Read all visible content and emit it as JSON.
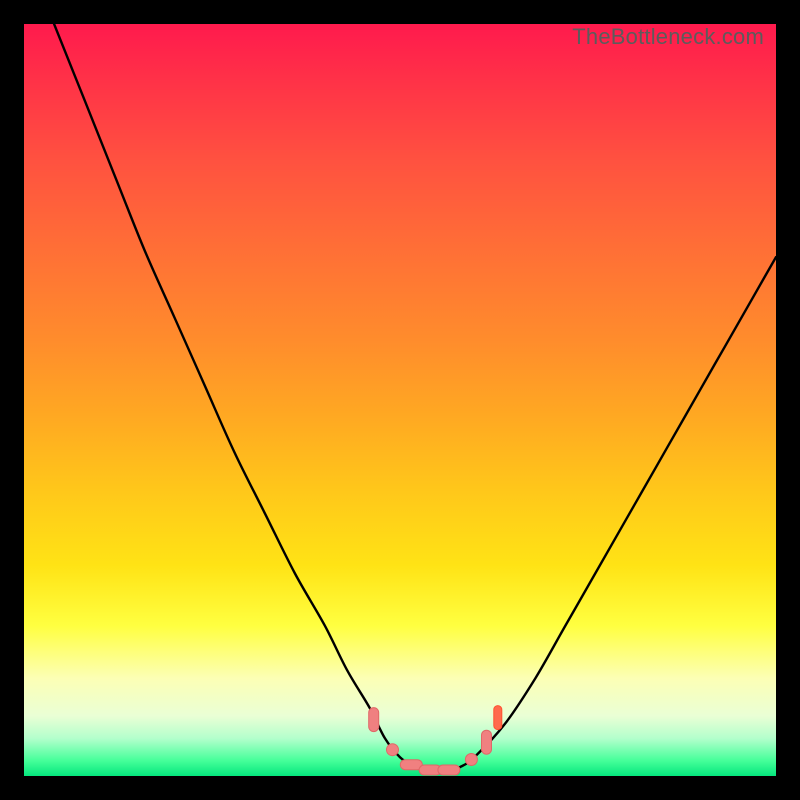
{
  "attribution": "TheBottleneck.com",
  "colors": {
    "frame": "#000000",
    "curve": "#000000",
    "markerFill": "#f08080",
    "markerStroke": "#e06868",
    "gradientStops": [
      "#ff1a4d",
      "#ff3347",
      "#ff5140",
      "#ff6f36",
      "#ff8c2c",
      "#ffa822",
      "#ffc71a",
      "#ffe315",
      "#ffff40",
      "#fcffb5",
      "#eaffd5",
      "#b3ffcc",
      "#44ff99",
      "#05e67d"
    ]
  },
  "chart_data": {
    "type": "line",
    "title": "",
    "xlabel": "",
    "ylabel": "",
    "xlim": [
      0,
      100
    ],
    "ylim": [
      0,
      100
    ],
    "series": [
      {
        "name": "bottleneck-curve",
        "x": [
          4,
          8,
          12,
          16,
          20,
          24,
          28,
          32,
          36,
          40,
          43,
          46,
          48,
          50,
          52,
          54,
          56,
          58,
          60,
          64,
          68,
          72,
          76,
          80,
          84,
          88,
          92,
          96,
          100
        ],
        "y": [
          100,
          90,
          80,
          70,
          61,
          52,
          43,
          35,
          27,
          20,
          14,
          9,
          5,
          2.5,
          1.2,
          0.6,
          0.6,
          1.2,
          2.6,
          7,
          13,
          20,
          27,
          34,
          41,
          48,
          55,
          62,
          69
        ]
      }
    ],
    "markers": [
      {
        "x": 46.5,
        "y": 7.5,
        "type": "pill-v"
      },
      {
        "x": 49.0,
        "y": 3.5,
        "type": "dot"
      },
      {
        "x": 51.5,
        "y": 1.5,
        "type": "pill-h"
      },
      {
        "x": 54.0,
        "y": 0.8,
        "type": "pill-h"
      },
      {
        "x": 56.5,
        "y": 0.8,
        "type": "pill-h"
      },
      {
        "x": 59.5,
        "y": 2.2,
        "type": "dot"
      },
      {
        "x": 61.5,
        "y": 4.5,
        "type": "pill-v"
      },
      {
        "x": 63.0,
        "y": 7.5,
        "type": "accent"
      }
    ]
  }
}
